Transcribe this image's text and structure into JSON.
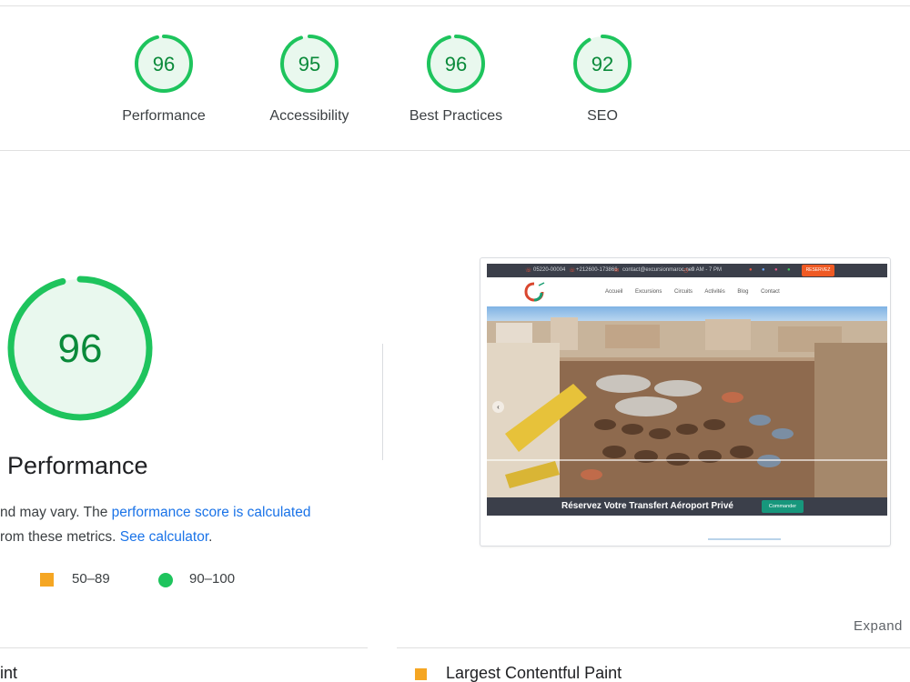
{
  "gauges": [
    {
      "score": "96",
      "label": "Performance"
    },
    {
      "score": "95",
      "label": "Accessibility"
    },
    {
      "score": "96",
      "label": "Best Practices"
    },
    {
      "score": "92",
      "label": "SEO"
    }
  ],
  "performance": {
    "score": "96",
    "title": "Performance",
    "desc_line1_prefix": "nd may vary. The ",
    "desc_link1": "performance score is calculated",
    "desc_line2_prefix": "rom these metrics. ",
    "desc_link2": "See calculator",
    "desc_line2_suffix": "."
  },
  "legend": {
    "average": "50–89",
    "good": "90–100"
  },
  "screenshot": {
    "topbar": {
      "phone1": "05220-00004",
      "phone2": "+212600-173866",
      "email": "contact@excursionmaroc.net",
      "hours": "9 AM - 7 PM",
      "cta": "RESERVEZ"
    },
    "nav": [
      "Accueil",
      "Excursions",
      "Circuits",
      "Activités",
      "Blog",
      "Contact"
    ],
    "banner_text": "Réservez Votre Transfert Aéroport Privé",
    "banner_button": "Commander"
  },
  "expand_label": "Expand",
  "metrics": {
    "left_partial": "int",
    "right": "Largest Contentful Paint"
  },
  "colors": {
    "pass": "#1ec45d",
    "pass_text": "#0a8a3a",
    "average": "#f5a623",
    "link": "#1a73e8"
  }
}
